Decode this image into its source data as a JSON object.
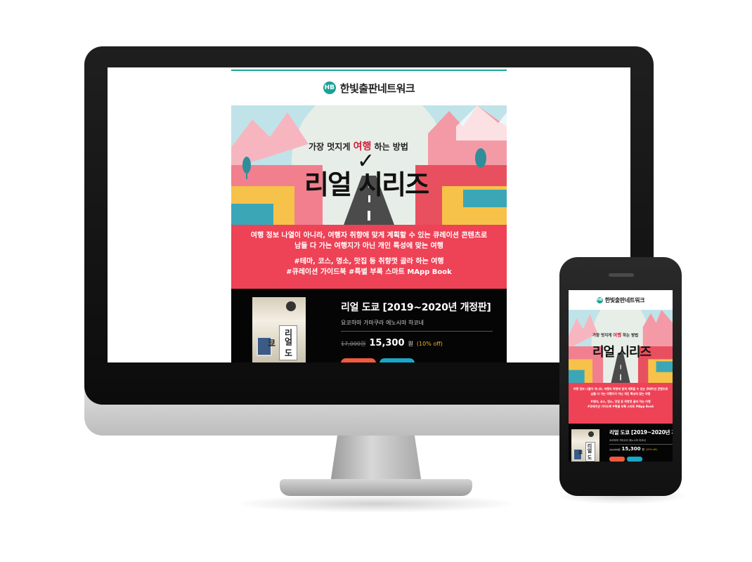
{
  "brand": {
    "logo_mark": "HB",
    "name": "한빛출판네트워크",
    "accent_color": "#1aa296"
  },
  "hero": {
    "subtitle_before": "가장 멋지게",
    "subtitle_highlight": "여행",
    "subtitle_after": "하는 방법",
    "title": "리얼 시리즈"
  },
  "promo": {
    "line1": "여행 정보 나열이 아니라, 여행자 취향에 맞게 계획할 수 있는 큐레이션 콘텐츠로",
    "line2": "남들 다 가는 여행지가 아닌 개인 특성에 맞는 여행",
    "hashtags1": "#테마, 코스, 명소, 맛집 등 취향껏 골라 하는 여행",
    "hashtags2": "#큐레이션 가이드북 #특별 부록 스마트 MApp Book",
    "bg_color": "#ee4256"
  },
  "book": {
    "cover_text": "리얼 도쿄",
    "title": "리얼 도쿄 [2019~2020년 개정판]",
    "authors": "요코하마 가마쿠라 에노시마 하코네",
    "price_original": "17,000원",
    "price_sale": "15,300",
    "price_unit": "원",
    "discount": "(10% off)",
    "discount_color": "#f1b21b"
  },
  "buttons": {
    "primary_color": "#f15a3c",
    "secondary_color": "#1aa6c8"
  },
  "icons": {
    "logo": "hanbit-logo-icon",
    "check": "checkmark-icon"
  }
}
